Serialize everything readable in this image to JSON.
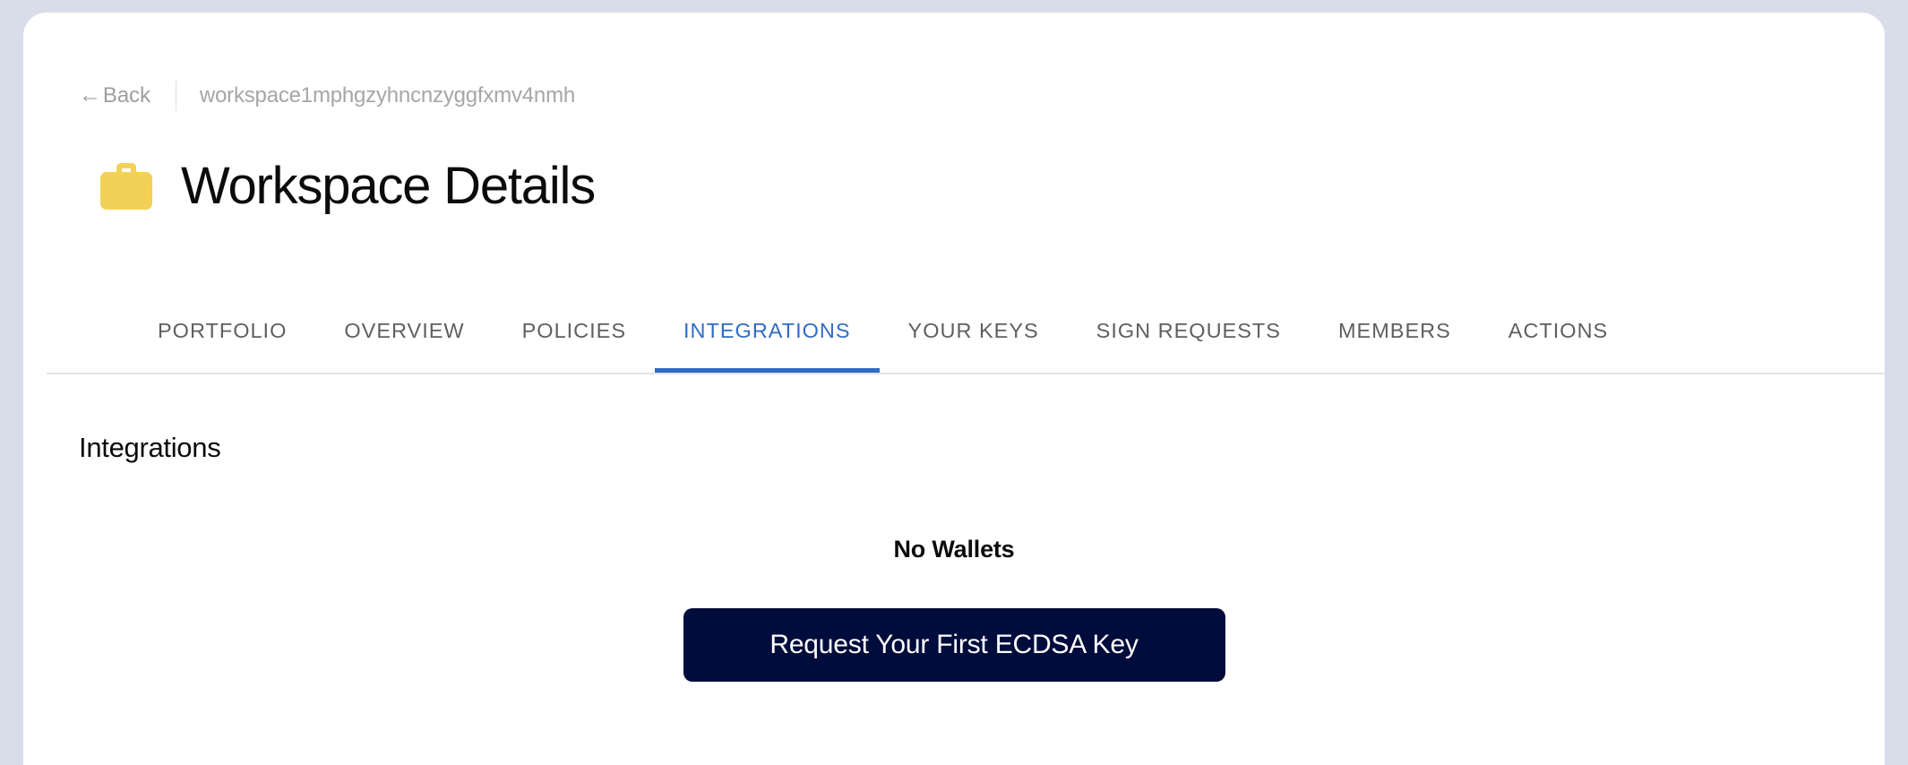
{
  "theme": {
    "page_background": "#d9dce9",
    "card_background": "#ffffff",
    "accent_blue": "#2f6cc4",
    "cta_navy": "#000c3b",
    "icon_gold": "#f3d157",
    "muted_text": "#9e9e9e"
  },
  "breadcrumb": {
    "back_arrow": "←",
    "back_label": "Back",
    "workspace_id": "workspace1mphgzyhncnzyggfxmv4nmh"
  },
  "header": {
    "icon": "briefcase-icon",
    "title": "Workspace Details"
  },
  "tabs": {
    "active_index": 3,
    "items": [
      {
        "label": "PORTFOLIO"
      },
      {
        "label": "OVERVIEW"
      },
      {
        "label": "POLICIES"
      },
      {
        "label": "INTEGRATIONS"
      },
      {
        "label": "YOUR KEYS"
      },
      {
        "label": "SIGN REQUESTS"
      },
      {
        "label": "MEMBERS"
      },
      {
        "label": "ACTIONS"
      }
    ]
  },
  "main": {
    "section_heading": "Integrations",
    "empty_state": {
      "title": "No Wallets",
      "cta_label": "Request Your First ECDSA Key"
    }
  }
}
